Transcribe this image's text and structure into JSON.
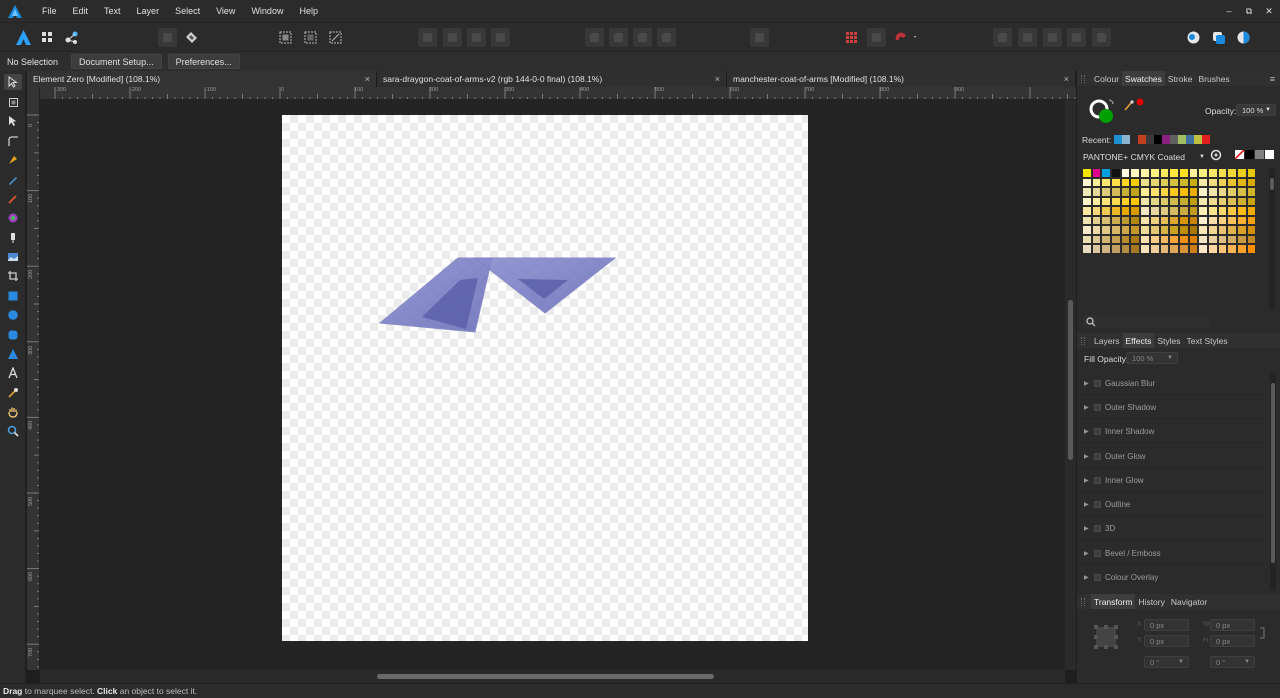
{
  "app": {
    "icon": "affinity-designer-logo-icon",
    "accent": "#1b8be0"
  },
  "menu": [
    "File",
    "Edit",
    "Text",
    "Layer",
    "Select",
    "View",
    "Window",
    "Help"
  ],
  "window_controls": {
    "minimize": "–",
    "restore": "⧉",
    "close": "✕"
  },
  "context": {
    "selection": "No Selection",
    "document_setup": "Document Setup...",
    "preferences": "Preferences..."
  },
  "tabs": [
    {
      "label": "Element Zero [Modified] (108.1%)",
      "close": "×"
    },
    {
      "label": "sara-draygon-coat-of-arms-v2 (rgb 144-0-0 final) (108.1%)",
      "close": "×"
    },
    {
      "label": "manchester-coat-of-arms [Modified] (108.1%)",
      "close": "×"
    }
  ],
  "ruler": {
    "h_labels": [
      "-300",
      "-200",
      "-100",
      "0",
      "100",
      "200",
      "300",
      "400",
      "500",
      "600",
      "700",
      "800",
      "900"
    ],
    "v_labels": [
      "0",
      "100",
      "200",
      "300",
      "400",
      "500",
      "600",
      "700"
    ]
  },
  "color_panel": {
    "tabs": [
      "Colour",
      "Swatches",
      "Stroke",
      "Brushes"
    ],
    "active_tab": "Swatches",
    "opacity_label": "Opacity:",
    "opacity_value": "100 %",
    "fill_color": "#00a000",
    "stroke_color": "#ffffff",
    "picker_color": "#e00000",
    "recent_label": "Recent:",
    "recent_colors": [
      "#1e90d0",
      "#8ab4d0",
      "#2a2a2a",
      "#c04020",
      "#3a3a3a",
      "#000000",
      "#8a2080",
      "#606060",
      "#a0c060",
      "#4070a0",
      "#c0c040",
      "#e02020"
    ],
    "palette_name": "PANTONE+ CMYK Coated",
    "quick_swatches": [
      "none",
      "#000000",
      "#808080",
      "#ffffff"
    ],
    "swatches": [
      "#f5e600",
      "#e0008c",
      "#00a0e0",
      "#111111",
      "#fffbe0",
      "#fff8c0",
      "#fff5a8",
      "#fff080",
      "#ffeb60",
      "#ffe640",
      "#ffe020",
      "#fff19a",
      "#fbef82",
      "#f7e868",
      "#f3e050",
      "#efd838",
      "#ebd020",
      "#e7c810",
      "#fff8d0",
      "#ffef9a",
      "#ffe770",
      "#ffde48",
      "#ffd620",
      "#f5cc00",
      "#ece08c",
      "#e4d670",
      "#dccc58",
      "#d4c240",
      "#ccb828",
      "#c4ae10",
      "#f9eaa8",
      "#f3dd80",
      "#edd058",
      "#e7c330",
      "#e1b610",
      "#d6aa00",
      "#f0e6b8",
      "#e6d898",
      "#dccb78",
      "#d2bd58",
      "#c8b038",
      "#bea218",
      "#ffec94",
      "#ffe06c",
      "#ffd444",
      "#ffc81c",
      "#f6bc00",
      "#eab000",
      "#f8f0c8",
      "#f0e4a8",
      "#e8d888",
      "#e0cc68",
      "#d8c048",
      "#d0b428",
      "#fff6c8",
      "#ffeda0",
      "#ffe478",
      "#ffdb50",
      "#ffd228",
      "#ffc900",
      "#efe5a6",
      "#e5d788",
      "#dbc96a",
      "#d1bb4c",
      "#c7ad2e",
      "#bd9f10",
      "#f7e9b0",
      "#eedb90",
      "#e5cd70",
      "#dcbf50",
      "#d3b130",
      "#caa310",
      "#fbe8a0",
      "#f6d878",
      "#f1c850",
      "#ecb828",
      "#e7a800",
      "#d89c00",
      "#f2e6c0",
      "#e8d6a0",
      "#decb80",
      "#d4bb60",
      "#caab40",
      "#c09b20",
      "#fff2b8",
      "#ffe490",
      "#ffd668",
      "#ffc840",
      "#ffba18",
      "#f5ac00",
      "#efe2b0",
      "#e3d090",
      "#d7be70",
      "#cbac50",
      "#bf9a30",
      "#b38810",
      "#f8e4a8",
      "#f0d080",
      "#e8bc58",
      "#e0a830",
      "#d89408",
      "#c88400",
      "#fff0d0",
      "#ffe0a8",
      "#ffd080",
      "#ffc058",
      "#ffb030",
      "#ffa008",
      "#f6e8c8",
      "#ecd8a8",
      "#e2c888",
      "#d8b868",
      "#cea848",
      "#c49828",
      "#f0dc98",
      "#e4c870",
      "#d8b448",
      "#cca020",
      "#c08c00",
      "#a87800",
      "#fae8b8",
      "#f2d694",
      "#eac470",
      "#e2b24c",
      "#daa028",
      "#d28e04",
      "#e8dcb0",
      "#dcc890",
      "#d0b470",
      "#c4a050",
      "#b88c30",
      "#ac7810",
      "#fde0b0",
      "#fbcc88",
      "#f9b860",
      "#f7a438",
      "#f59010",
      "#e08000",
      "#f3e3c3",
      "#e9d1a3",
      "#dfbf83",
      "#d5ad63",
      "#cb9b43",
      "#c18923",
      "#eadcc0",
      "#dcc8a0",
      "#ceb480",
      "#c0a060",
      "#b28c40",
      "#a47820",
      "#f7e1b7",
      "#efcd97",
      "#e7b977",
      "#dfa557",
      "#d79137",
      "#cf7d17",
      "#ffe8c8",
      "#ffd6a0",
      "#ffc478",
      "#ffb250",
      "#ffa028",
      "#ff8e00"
    ],
    "search_icon": "search-icon"
  },
  "effects_panel": {
    "tabs": [
      "Layers",
      "Effects",
      "Styles",
      "Text Styles"
    ],
    "active_tab": "Effects",
    "fill_opacity_label": "Fill Opacity:",
    "fill_opacity_value": "100 %",
    "effects": [
      "Gaussian Blur",
      "Outer Shadow",
      "Inner Shadow",
      "Outer Glow",
      "Inner Glow",
      "Outline",
      "3D",
      "Bevel / Emboss",
      "Colour Overlay"
    ]
  },
  "transform_panel": {
    "tabs": [
      "Transform",
      "History",
      "Navigator"
    ],
    "active_tab": "Transform",
    "x": "0 px",
    "y": "0 px",
    "w": "0 px",
    "h": "0 px",
    "rotation": "0 °",
    "shear": "0 °"
  },
  "status": {
    "drag": "Drag",
    "drag_text": " to marquee select. ",
    "click": "Click",
    "click_text": " an object to select it."
  }
}
